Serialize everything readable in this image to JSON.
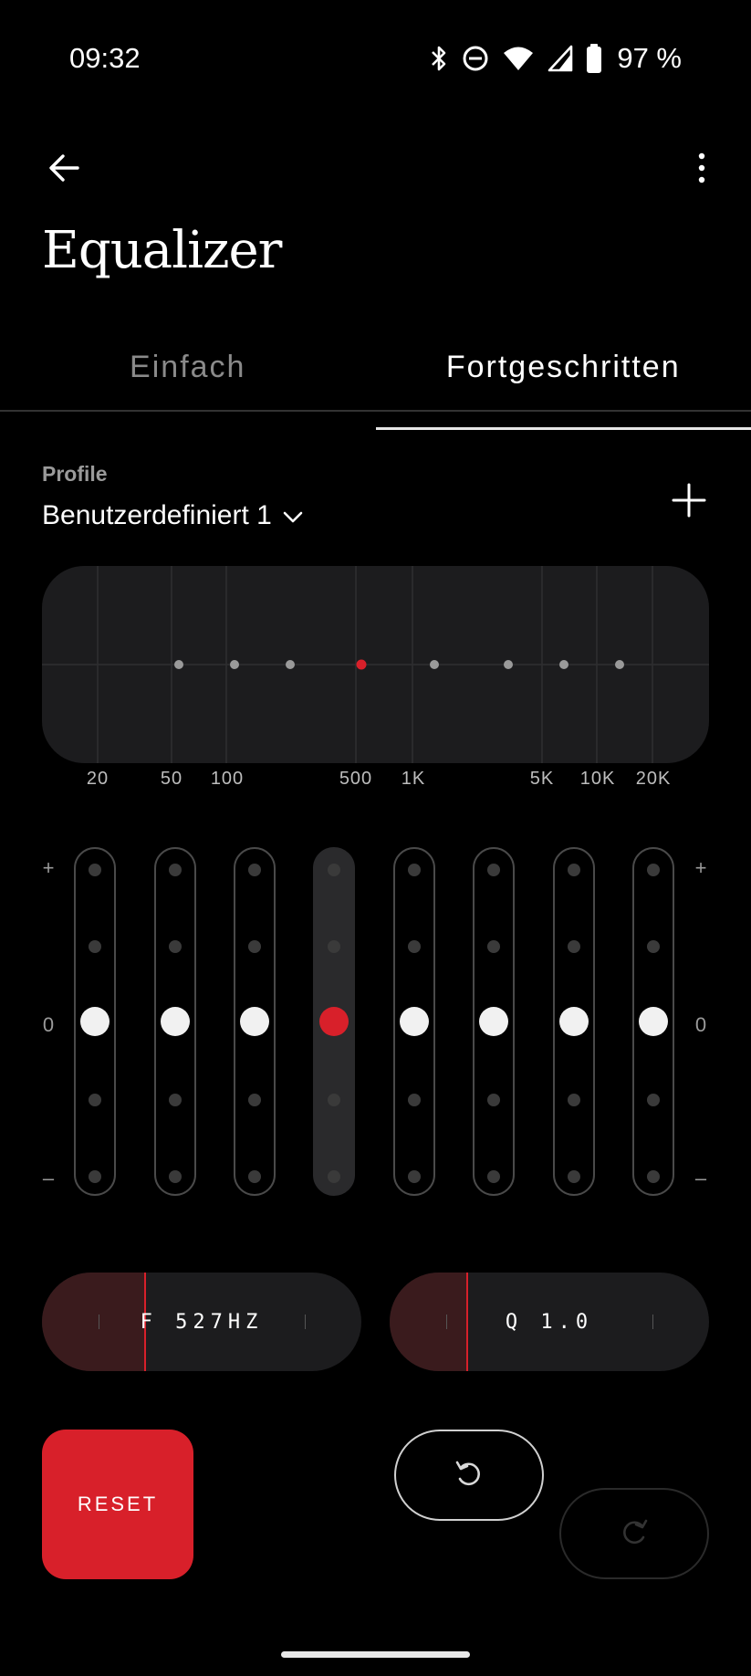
{
  "status_bar": {
    "time": "09:32",
    "battery_percent": "97 %",
    "icons": [
      "bluetooth-icon",
      "do-not-disturb-icon",
      "wifi-icon",
      "signal-icon",
      "battery-icon"
    ]
  },
  "app_bar": {
    "title": "Equalizer",
    "back_icon": "arrow-left-icon",
    "menu_icon": "more-vertical-icon"
  },
  "tabs": [
    {
      "label": "Einfach",
      "active": false
    },
    {
      "label": "Fortgeschritten",
      "active": true
    }
  ],
  "profile": {
    "label": "Profile",
    "selected": "Benutzerdefiniert 1",
    "add_icon": "plus-icon"
  },
  "graph": {
    "frequency_labels": [
      "20",
      "50",
      "100",
      "500",
      "1K",
      "5K",
      "10K",
      "20K"
    ]
  },
  "sliders": {
    "plus_label": "+",
    "zero_label": "0",
    "minus_label": "–",
    "bands": [
      {
        "level": 0,
        "selected": false
      },
      {
        "level": 0,
        "selected": false
      },
      {
        "level": 0,
        "selected": false
      },
      {
        "level": 0,
        "selected": true
      },
      {
        "level": 0,
        "selected": false
      },
      {
        "level": 0,
        "selected": false
      },
      {
        "level": 0,
        "selected": false
      },
      {
        "level": 0,
        "selected": false
      }
    ]
  },
  "parameters": {
    "frequency": {
      "text": "F 527HZ",
      "fill_fraction": 0.32
    },
    "q": {
      "text": "Q 1.0",
      "fill_fraction": 0.24
    }
  },
  "buttons": {
    "reset_label": "RESET",
    "undo_icon": "undo-icon",
    "redo_icon": "redo-icon"
  },
  "colors": {
    "accent": "#d8202a",
    "background": "#000000",
    "surface": "#1c1c1e"
  }
}
